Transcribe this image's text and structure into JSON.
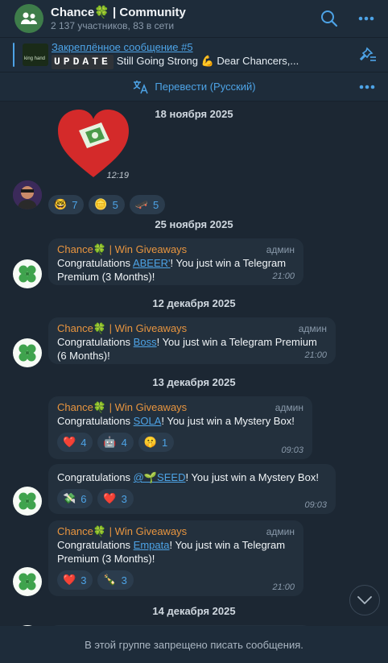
{
  "header": {
    "title": "Chance🍀 | Community",
    "subtitle": "2 137 участников, 83 в сети"
  },
  "pinned": {
    "title": "Закреплённое сообщение #5",
    "badge": "UPDATE",
    "text": "Still Going Strong 💪 Dear Chancers,...",
    "thumb_text": "king hand"
  },
  "translate": {
    "label": "Перевести (Русский)"
  },
  "messages": {
    "sticker": {
      "time": "12:19",
      "reactions": [
        {
          "emoji": "🤓",
          "count": "7"
        },
        {
          "emoji": "🪙",
          "count": "5"
        },
        {
          "emoji": "🛹",
          "count": "5"
        }
      ]
    },
    "dates": [
      "18 ноября 2025",
      "25 ноября 2025",
      "12 декабря 2025",
      "13 декабря 2025",
      "14 декабря 2025"
    ],
    "m1": {
      "sender": "Chance🍀 | Win Giveaways",
      "role": "админ",
      "pre": "Congratulations ",
      "mention": "ABEER'",
      "post": "! You just win a Telegram Premium (3 Months)!",
      "time": "21:00"
    },
    "m2": {
      "sender": "Chance🍀 | Win Giveaways",
      "role": "админ",
      "pre": "Congratulations ",
      "mention": "Boss",
      "post": "! You just win a Telegram Premium (6 Months)!",
      "time": "21:00"
    },
    "m3": {
      "sender": "Chance🍀 | Win Giveaways",
      "role": "админ",
      "pre": "Congratulations ",
      "mention": "SOLA",
      "post": "! You just win a Mystery Box!",
      "time": "09:03",
      "reactions": [
        {
          "emoji": "❤️",
          "count": "4"
        },
        {
          "emoji": "🤖",
          "count": "4"
        },
        {
          "emoji": "🤫",
          "count": "1"
        }
      ]
    },
    "m4": {
      "pre": "Congratulations ",
      "mention": "@🌱SEED",
      "post": "! You just win a Mystery Box!",
      "time": "09:03",
      "reactions": [
        {
          "emoji": "💸",
          "count": "6"
        },
        {
          "emoji": "❤️",
          "count": "3"
        }
      ]
    },
    "m5": {
      "sender": "Chance🍀 | Win Giveaways",
      "role": "админ",
      "pre": "Congratulations ",
      "mention": "Empata",
      "post": "! You just win a Telegram Premium (3 Months)!",
      "time": "21:00",
      "reactions": [
        {
          "emoji": "❤️",
          "count": "3"
        },
        {
          "emoji": "🍾",
          "count": "3"
        }
      ]
    }
  },
  "footer": {
    "text": "В этой группе запрещено писать сообщения."
  },
  "colors": {
    "accent": "#4da3e6",
    "sender": "#e8953f",
    "background": "#1c2733",
    "bubble": "#23303d"
  }
}
